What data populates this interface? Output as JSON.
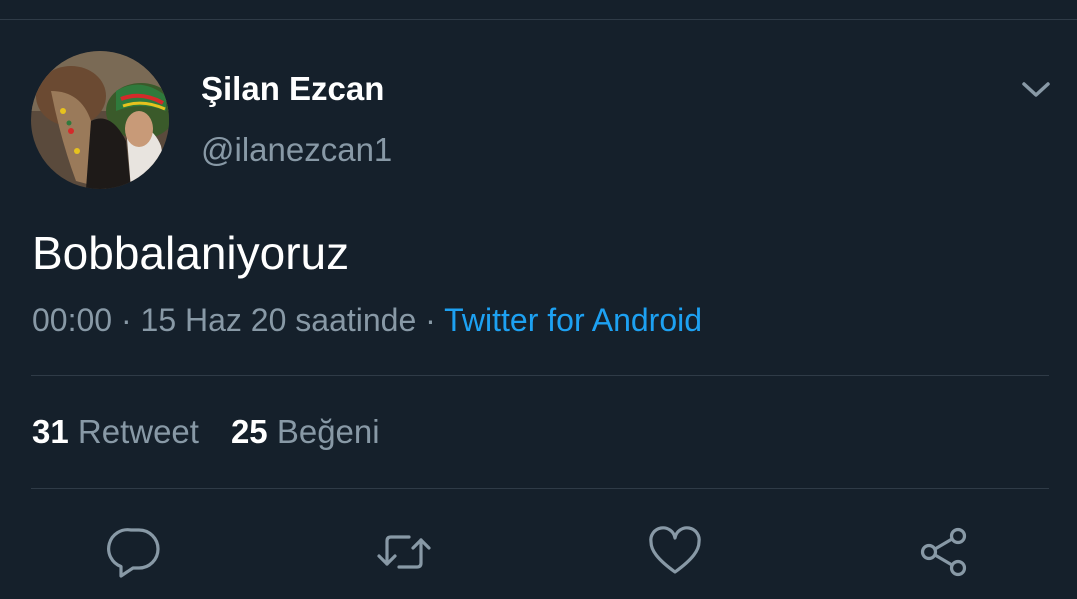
{
  "tweet": {
    "author": {
      "display_name": "Şilan Ezcan",
      "handle": "@ilanezcan1",
      "avatar": "avatar-photo"
    },
    "menu_icon": "chevron-down-icon",
    "text": "Bobbalaniyoruz",
    "meta": {
      "time": "00:00",
      "date": "15 Haz 20 saatinde",
      "separator": " · ",
      "source": "Twitter for Android"
    },
    "stats": {
      "retweets_count": "31",
      "retweets_label": "Retweet",
      "likes_count": "25",
      "likes_label": "Beğeni"
    },
    "actions": [
      {
        "name": "reply",
        "icon": "reply-icon"
      },
      {
        "name": "retweet",
        "icon": "retweet-icon"
      },
      {
        "name": "like",
        "icon": "heart-icon"
      },
      {
        "name": "share",
        "icon": "share-icon"
      }
    ]
  },
  "colors": {
    "background": "#15202b",
    "primary_text": "#ffffff",
    "secondary_text": "#8899a6",
    "accent": "#1da1f2",
    "divider": "#2f3b47"
  }
}
